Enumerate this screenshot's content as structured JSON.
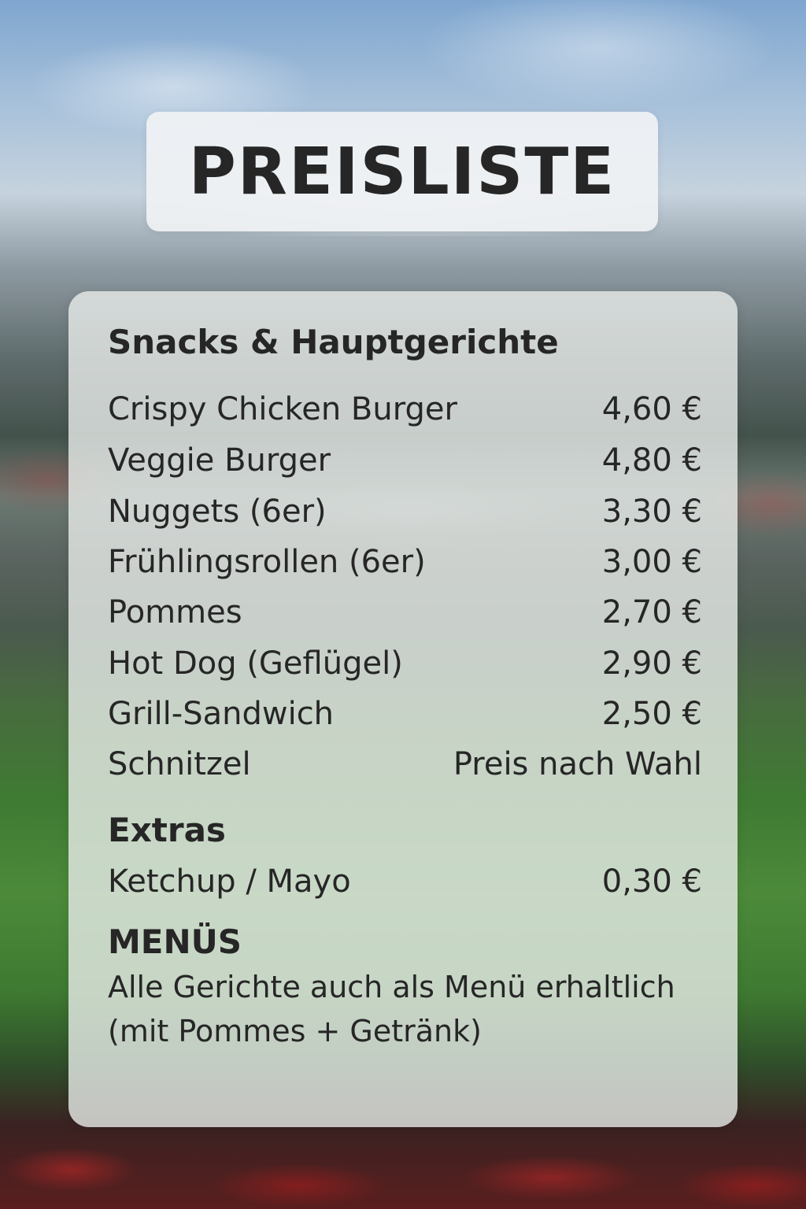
{
  "title": "PREISLISTE",
  "sections": {
    "snacks": {
      "heading": "Snacks & Hauptgerichte",
      "items": [
        {
          "name": "Crispy Chicken Burger",
          "price": "4,60 €"
        },
        {
          "name": "Veggie Burger",
          "price": "4,80 €"
        },
        {
          "name": "Nuggets (6er)",
          "price": "3,30 €"
        },
        {
          "name": "Frühlingsrollen (6er)",
          "price": "3,00 €"
        },
        {
          "name": "Pommes",
          "price": "2,70 €"
        },
        {
          "name": "Hot Dog (Geflügel)",
          "price": "2,90 €"
        },
        {
          "name": "Grill-Sandwich",
          "price": "2,50 €"
        },
        {
          "name": "Schnitzel",
          "price": "Preis nach Wahl"
        }
      ]
    },
    "extras": {
      "heading": "Extras",
      "items": [
        {
          "name": "Ketchup / Mayo",
          "price": "0,30 €"
        }
      ]
    },
    "menus": {
      "heading": "MENÜS",
      "line1": "Alle Gerichte auch als Menü erhaltlich",
      "line2": "(mit Pommes + Getränk)"
    }
  }
}
